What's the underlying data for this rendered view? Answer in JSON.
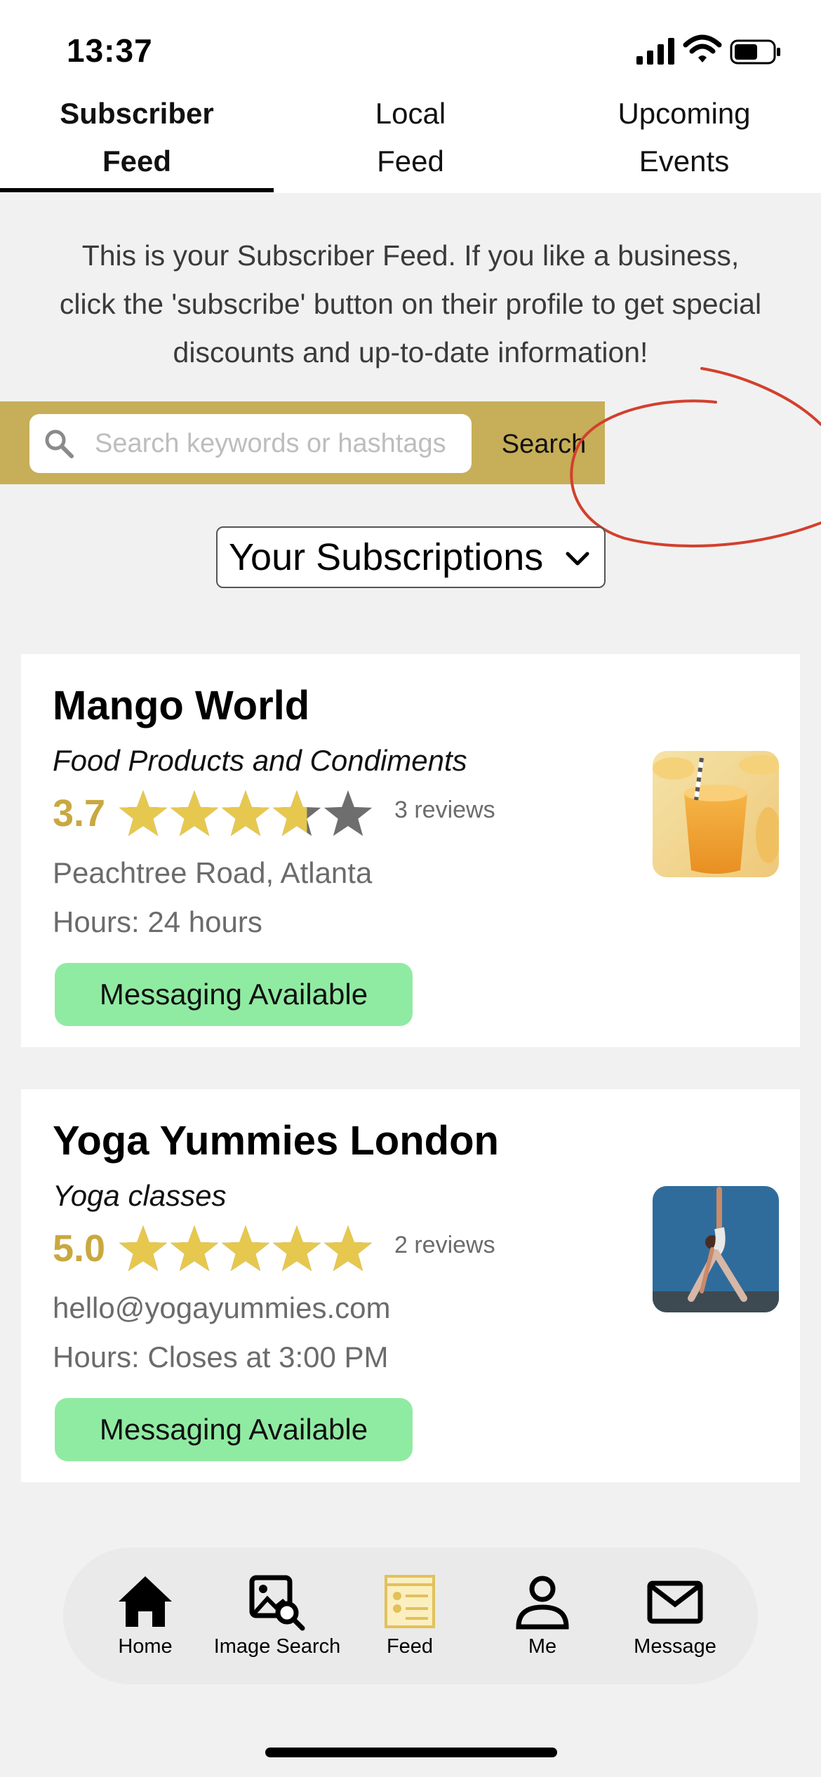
{
  "status_bar": {
    "time": "13:37"
  },
  "tabs": [
    {
      "line1": "Subscriber",
      "line2": "Feed",
      "active": true
    },
    {
      "line1": "Local",
      "line2": "Feed",
      "active": false
    },
    {
      "line1": "Upcoming",
      "line2": "Events",
      "active": false
    }
  ],
  "intro": "This is your Subscriber Feed. If you like a business, click the 'subscribe' button on their profile to get special discounts and up-to-date information!",
  "search": {
    "placeholder": "Search keywords or hashtags",
    "button": "Search"
  },
  "dropdown": {
    "label": "Your Subscriptions"
  },
  "businesses": [
    {
      "name": "Mango World",
      "category": "Food Products and Condiments",
      "rating": "3.7",
      "rating_value": 3.7,
      "reviews": "3 reviews",
      "address": "Peachtree Road, Atlanta",
      "hours_label": "Hours:",
      "hours": "24 hours",
      "messaging": "Messaging Available",
      "thumb_icon": "mango-smoothie-photo"
    },
    {
      "name": "Yoga Yummies London",
      "category": "Yoga classes",
      "rating": "5.0",
      "rating_value": 5.0,
      "reviews": "2 reviews",
      "address": "hello@yogayummies.com",
      "hours_label": "Hours:",
      "hours": "Closes at 3:00 PM",
      "messaging": "Messaging Available",
      "thumb_icon": "yoga-pose-photo"
    }
  ],
  "nav": [
    {
      "label": "Home",
      "icon": "home-icon"
    },
    {
      "label": "Image Search",
      "icon": "image-search-icon"
    },
    {
      "label": "Feed",
      "icon": "feed-icon",
      "active": true
    },
    {
      "label": "Me",
      "icon": "person-icon"
    },
    {
      "label": "Message",
      "icon": "envelope-icon"
    }
  ],
  "colors": {
    "accent_gold": "#c7ae58",
    "star_gold": "#e6c84f",
    "star_gray": "#6e6e6e",
    "messaging_green": "#90eba2",
    "annotation_red": "#d2402d"
  }
}
